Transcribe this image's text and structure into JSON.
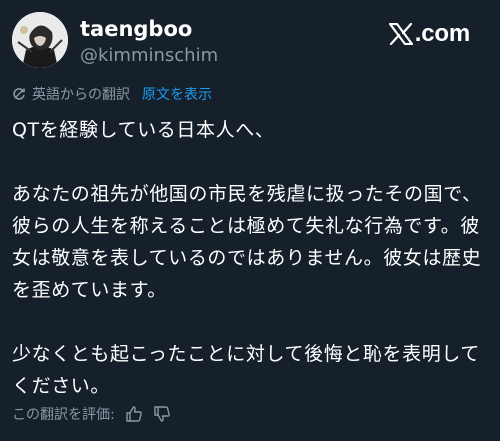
{
  "user": {
    "display_name": "taengboo",
    "handle": "@kimminschim"
  },
  "brand": {
    "text": ".com"
  },
  "translation": {
    "label": "英語からの翻訳",
    "show_original": "原文を表示"
  },
  "tweet": {
    "text": "QTを経験している日本人へ、\n\nあなたの祖先が他国の市民を残虐に扱ったその国で、彼らの人生を称えることは極めて失礼な行為です。彼女は敬意を表しているのではありません。彼女は歴史を歪めています。\n\n少なくとも起こったことに対して後悔と恥を表明してください。"
  },
  "rate": {
    "label": "この翻訳を評価:"
  },
  "colors": {
    "background": "#15202b",
    "link": "#1d9bf0",
    "secondary_text": "#8b98a5"
  }
}
